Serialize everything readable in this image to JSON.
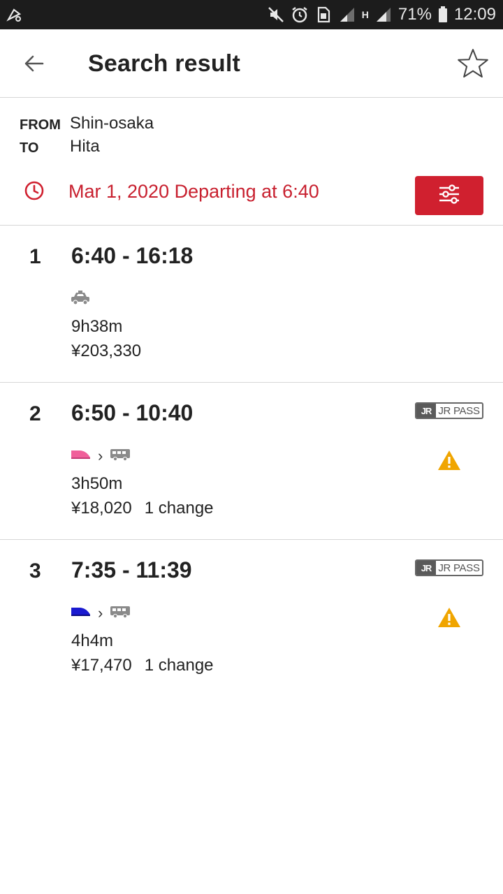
{
  "status_bar": {
    "battery": "71%",
    "time": "12:09",
    "network_type": "H",
    "icons": [
      "notification-icon",
      "mute-icon",
      "alarm-icon",
      "sim-icon",
      "signal-icon",
      "battery-icon"
    ]
  },
  "app_bar": {
    "title": "Search result",
    "back_icon": "arrow-left-icon",
    "favorite_icon": "star-outline-icon"
  },
  "route": {
    "from_label": "FROM",
    "from_value": "Shin-osaka",
    "to_label": "TO",
    "to_value": "Hita",
    "departure": "Mar 1, 2020 Departing at 6:40",
    "accent_color": "#d0202f"
  },
  "results": [
    {
      "index": "1",
      "times": "6:40 - 16:18",
      "modes": [
        "taxi-icon"
      ],
      "duration": "9h38m",
      "fare": "¥203,330",
      "changes": "",
      "jr_pass": false,
      "warning": false
    },
    {
      "index": "2",
      "times": "6:50 - 10:40",
      "modes": [
        "shinkansen-pink-icon",
        "bus-icon"
      ],
      "duration": "3h50m",
      "fare": "¥18,020",
      "changes": "1 change",
      "jr_pass": true,
      "jr_pass_logo": "JR",
      "jr_pass_label": "JR PASS",
      "warning": true
    },
    {
      "index": "3",
      "times": "7:35 - 11:39",
      "modes": [
        "shinkansen-blue-icon",
        "bus-icon"
      ],
      "duration": "4h4m",
      "fare": "¥17,470",
      "changes": "1 change",
      "jr_pass": true,
      "jr_pass_logo": "JR",
      "jr_pass_label": "JR PASS",
      "warning": true
    }
  ],
  "colors": {
    "accent_red": "#d0202f",
    "warning_orange": "#f0a500",
    "shinkansen_pink": "#f0609a",
    "shinkansen_blue": "#1a1ad0"
  }
}
